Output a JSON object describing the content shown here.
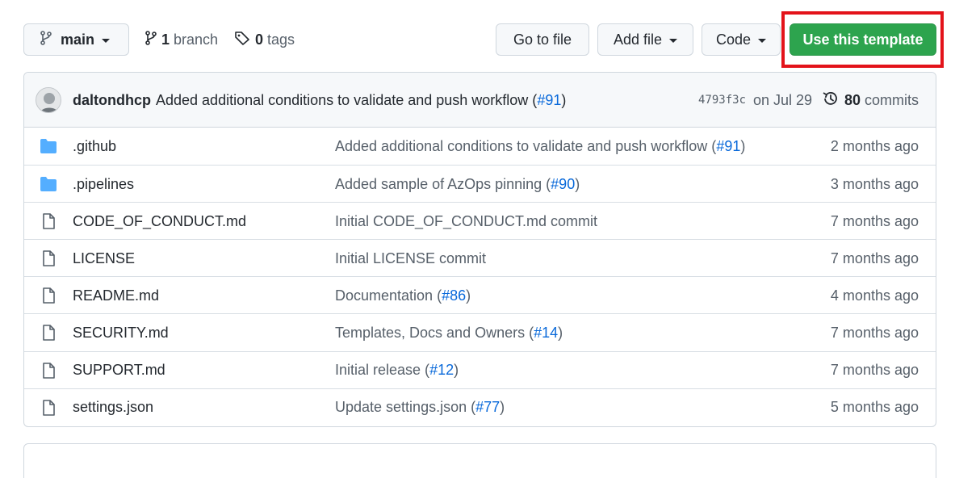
{
  "toolbar": {
    "branch_label": "main",
    "branch_count": "1",
    "branch_word": "branch",
    "tag_count": "0",
    "tag_word": "tags",
    "goto_file_label": "Go to file",
    "add_file_label": "Add file",
    "code_label": "Code",
    "use_template_label": "Use this template"
  },
  "commit": {
    "author": "daltondhcp",
    "message": "Added additional conditions to validate and push workflow (",
    "pr": "#91",
    "message_end": ")",
    "hash": "4793f3c",
    "date": "on Jul 29",
    "commit_count": "80",
    "commit_word": "commits"
  },
  "files": [
    {
      "name": ".github",
      "type": "folder",
      "msg": "Added additional conditions to validate and push workflow (",
      "pr": "#91",
      "msg_end": ")",
      "age": "2 months ago"
    },
    {
      "name": ".pipelines",
      "type": "folder",
      "msg": "Added sample of AzOps pinning (",
      "pr": "#90",
      "msg_end": ")",
      "age": "3 months ago"
    },
    {
      "name": "CODE_OF_CONDUCT.md",
      "type": "file",
      "msg": "Initial CODE_OF_CONDUCT.md commit",
      "pr": "",
      "msg_end": "",
      "age": "7 months ago"
    },
    {
      "name": "LICENSE",
      "type": "file",
      "msg": "Initial LICENSE commit",
      "pr": "",
      "msg_end": "",
      "age": "7 months ago"
    },
    {
      "name": "README.md",
      "type": "file",
      "msg": "Documentation (",
      "pr": "#86",
      "msg_end": ")",
      "age": "4 months ago"
    },
    {
      "name": "SECURITY.md",
      "type": "file",
      "msg": "Templates, Docs and Owners (",
      "pr": "#14",
      "msg_end": ")",
      "age": "7 months ago"
    },
    {
      "name": "SUPPORT.md",
      "type": "file",
      "msg": "Initial release (",
      "pr": "#12",
      "msg_end": ")",
      "age": "7 months ago"
    },
    {
      "name": "settings.json",
      "type": "file",
      "msg": "Update settings.json (",
      "pr": "#77",
      "msg_end": ")",
      "age": "5 months ago"
    }
  ],
  "colors": {
    "primary_button": "#2da44e",
    "highlight_box": "#e3131a",
    "link": "#0969da",
    "folder_icon": "#54aeff"
  }
}
